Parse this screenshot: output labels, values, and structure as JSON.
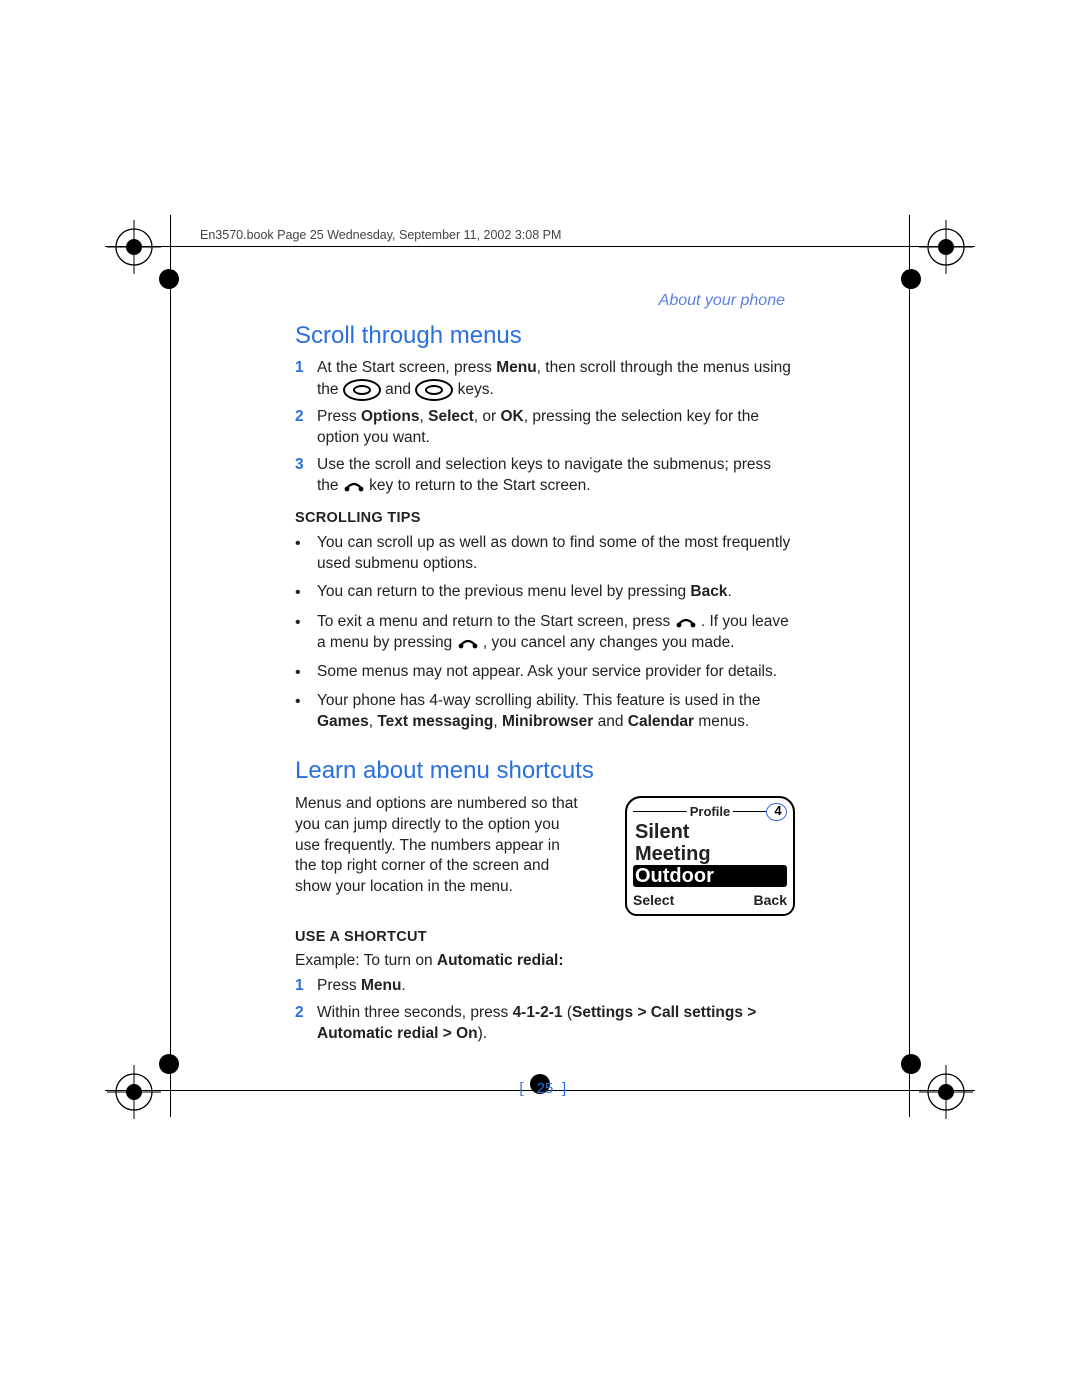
{
  "meta": {
    "header_line": "En3570.book  Page 25  Wednesday, September 11, 2002  3:08 PM",
    "section": "About your phone",
    "page_number": "25"
  },
  "section1": {
    "title": "Scroll through menus",
    "steps": {
      "1": {
        "num": "1",
        "a": "At the Start screen, press ",
        "b_bold": "Menu",
        "c": ", then scroll through the menus using the ",
        "d": " and ",
        "e": " keys."
      },
      "2": {
        "num": "2",
        "a": "Press ",
        "b_bold": "Options",
        "c": ", ",
        "d_bold": "Select",
        "e": ", or ",
        "f_bold": "OK",
        "g": ", pressing the selection key for the option you want."
      },
      "3": {
        "num": "3",
        "a": "Use the scroll and selection keys to navigate the submenus; press the ",
        "b": " key to return to the Start screen."
      }
    },
    "tips_head": "SCROLLING TIPS",
    "tips": {
      "1": "You can scroll up as well as down to find some of the most frequently used submenu options.",
      "2": {
        "a": "You can return to the previous menu level by pressing ",
        "b_bold": "Back",
        "c": "."
      },
      "3": {
        "a": "To exit a menu and return to the Start screen, press ",
        "b": " . If you leave a menu by pressing ",
        "c": " , you cancel any changes you made."
      },
      "4": "Some menus may not appear. Ask your service provider for details.",
      "5": {
        "a": "Your phone has 4-way scrolling ability. This feature is used in the ",
        "b_bold": "Games",
        "c": ", ",
        "d_bold": "Text messaging",
        "e": ", ",
        "f_bold": "Minibrowser",
        "g": " and ",
        "h_bold": "Calendar",
        "i": " menus."
      }
    }
  },
  "section2": {
    "title": "Learn about menu shortcuts",
    "intro": "Menus and options are numbered so that you can jump directly to the option you use frequently. The numbers appear in the top right corner of the screen and show your location in the menu.",
    "fig": {
      "header_label": "Profile",
      "header_num": "4",
      "row1": "Silent",
      "row2": "Meeting",
      "row3": "Outdoor",
      "soft_left": "Select",
      "soft_right": "Back"
    },
    "sub_head": "USE A SHORTCUT",
    "example": {
      "a": "Example: To turn on ",
      "b_bold": "Automatic redial:"
    },
    "steps": {
      "1": {
        "num": "1",
        "a": "Press ",
        "b_bold": "Menu",
        "c": "."
      },
      "2": {
        "num": "2",
        "a": "Within three seconds, press ",
        "b_bold": "4-1-2-1",
        "c": " (",
        "d_bold": "Settings > Call settings > Automatic redial > On",
        "e": ")."
      }
    }
  }
}
